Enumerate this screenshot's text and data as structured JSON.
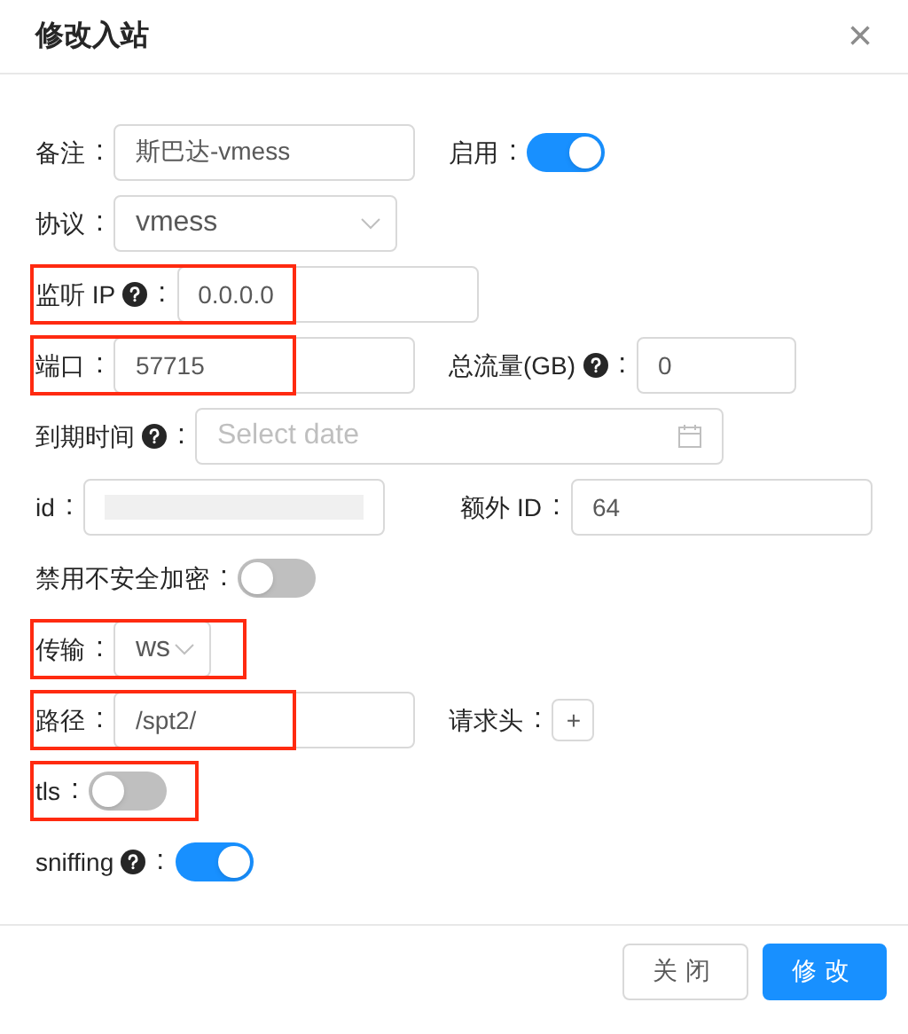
{
  "dialog": {
    "title": "修改入站",
    "close": "×"
  },
  "rows": [
    {
      "highlighted": false,
      "items": [
        {
          "kind": "text",
          "label": "备注",
          "help": false,
          "value": "斯巴达-vmess"
        },
        {
          "kind": "switch",
          "label": "启用",
          "help": false,
          "on": true
        }
      ]
    },
    {
      "highlighted": false,
      "items": [
        {
          "kind": "select",
          "label": "协议",
          "help": false,
          "value": "vmess"
        }
      ]
    },
    {
      "highlighted": true,
      "items": [
        {
          "kind": "text",
          "label": "监听 IP",
          "help": true,
          "value": "0.0.0.0"
        }
      ]
    },
    {
      "highlighted": true,
      "items": [
        {
          "kind": "text",
          "label": "端口",
          "help": false,
          "value": "57715"
        },
        {
          "kind": "text",
          "label": "总流量(GB)",
          "help": true,
          "value": "0"
        }
      ]
    },
    {
      "highlighted": false,
      "items": [
        {
          "kind": "date",
          "label": "到期时间",
          "help": true,
          "placeholder": "Select date"
        }
      ]
    },
    {
      "highlighted": false,
      "items": [
        {
          "kind": "redacted",
          "label": "id",
          "help": false
        },
        {
          "kind": "text",
          "label": "额外 ID",
          "help": false,
          "value": "64"
        }
      ]
    },
    {
      "highlighted": false,
      "items": [
        {
          "kind": "switch",
          "label": "禁用不安全加密",
          "help": false,
          "on": false
        }
      ]
    },
    {
      "highlighted": true,
      "items": [
        {
          "kind": "select",
          "label": "传输",
          "help": false,
          "value": "ws"
        }
      ]
    },
    {
      "highlighted": true,
      "items": [
        {
          "kind": "text",
          "label": "路径",
          "help": false,
          "value": "/spt2/"
        },
        {
          "kind": "button",
          "label": "请求头",
          "help": false,
          "value": "+"
        }
      ]
    },
    {
      "highlighted": true,
      "items": [
        {
          "kind": "switch",
          "label": "tls",
          "help": false,
          "on": false
        }
      ]
    },
    {
      "highlighted": false,
      "items": [
        {
          "kind": "switch",
          "label": "sniffing",
          "help": true,
          "on": true
        }
      ]
    }
  ],
  "colon": ":",
  "buttons": [
    {
      "label": "关闭",
      "primary": false
    },
    {
      "label": "修改",
      "primary": true
    }
  ]
}
